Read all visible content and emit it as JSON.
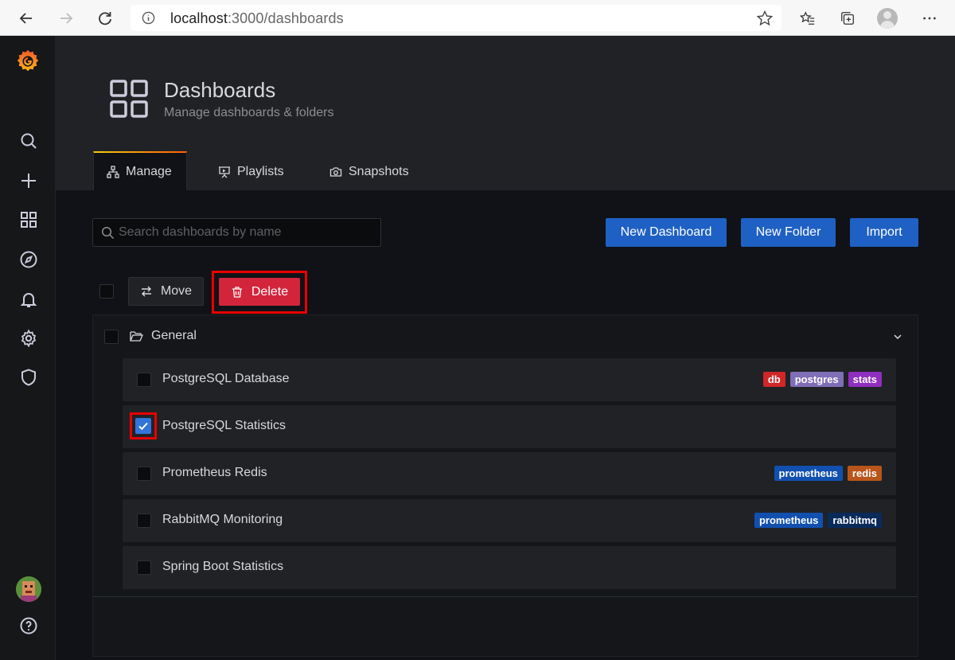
{
  "browser": {
    "url_host": "localhost",
    "url_path": ":3000/dashboards"
  },
  "page": {
    "title": "Dashboards",
    "subtitle": "Manage dashboards & folders"
  },
  "tabs": [
    {
      "label": "Manage",
      "icon": "sitemap-icon",
      "active": true
    },
    {
      "label": "Playlists",
      "icon": "presentation-icon",
      "active": false
    },
    {
      "label": "Snapshots",
      "icon": "camera-icon",
      "active": false
    }
  ],
  "search": {
    "placeholder": "Search dashboards by name"
  },
  "actions": {
    "new_dashboard": "New Dashboard",
    "new_folder": "New Folder",
    "import": "Import",
    "move": "Move",
    "delete": "Delete"
  },
  "folder": {
    "name": "General"
  },
  "dashboards": [
    {
      "title": "PostgreSQL Database",
      "checked": false,
      "tags": [
        {
          "label": "db",
          "color": "#d1262a"
        },
        {
          "label": "postgres",
          "color": "#806eb7"
        },
        {
          "label": "stats",
          "color": "#8f2ebf"
        }
      ]
    },
    {
      "title": "PostgreSQL Statistics",
      "checked": true,
      "tags": []
    },
    {
      "title": "Prometheus Redis",
      "checked": false,
      "tags": [
        {
          "label": "prometheus",
          "color": "#1250b0"
        },
        {
          "label": "redis",
          "color": "#b9551a"
        }
      ]
    },
    {
      "title": "RabbitMQ Monitoring",
      "checked": false,
      "tags": [
        {
          "label": "prometheus",
          "color": "#1250b0"
        },
        {
          "label": "rabbitmq",
          "color": "#0a2a5a"
        }
      ]
    },
    {
      "title": "Spring Boot Statistics",
      "checked": false,
      "tags": []
    }
  ],
  "colors": {
    "primary": "#1f60c4",
    "danger": "#d2253b",
    "highlight": "#e90000"
  }
}
